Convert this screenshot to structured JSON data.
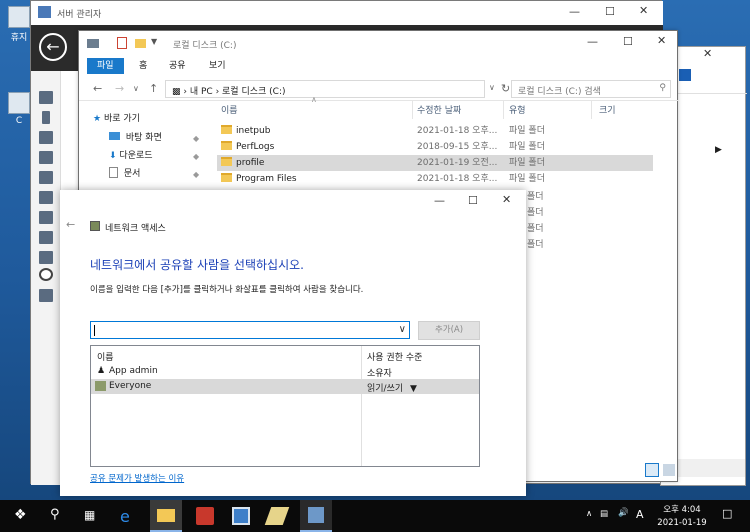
{
  "server_manager": {
    "title": "서버 관리자"
  },
  "desktop": {
    "icon1_label": "휴지",
    "icon2_label": "C"
  },
  "explorer": {
    "title": "로컬 디스크 (C:)",
    "ribbon_tabs": [
      "파일",
      "홈",
      "공유",
      "보기"
    ],
    "address_parts": [
      "내 PC",
      "로컬 디스크 (C:)"
    ],
    "search_placeholder": "로컬 디스크 (C:) 검색",
    "columns": [
      "이름",
      "수정한 날짜",
      "유형",
      "크기"
    ],
    "nav": {
      "quick_access": "바로 가기",
      "items": [
        "바탕 화면",
        "다운로드",
        "문서"
      ]
    },
    "files": [
      {
        "name": "inetpub",
        "date": "2021-01-18 오후...",
        "type": "파일 폴더"
      },
      {
        "name": "PerfLogs",
        "date": "2018-09-15 오후...",
        "type": "파일 폴더"
      },
      {
        "name": "profile",
        "date": "2021-01-19 오전...",
        "type": "파일 폴더"
      },
      {
        "name": "Program Files",
        "date": "2021-01-18 오후...",
        "type": "파일 폴더"
      }
    ],
    "extra_types": [
      "폴더",
      "폴더",
      "폴더",
      "폴더"
    ]
  },
  "dialog": {
    "title": "네트워크 액세스",
    "heading": "네트워크에서 공유할 사람을 선택하십시오.",
    "instruction": "이름을 입력한 다음 [추가]를 클릭하거나 화살표를 클릭하여 사람을 찾습니다.",
    "input_value": "",
    "add_button": "추가(A)",
    "list_headers": [
      "이름",
      "사용 권한 수준"
    ],
    "entries": [
      {
        "name": "App admin",
        "permission": "소유자"
      },
      {
        "name": "Everyone",
        "permission": "읽기/쓰기"
      }
    ],
    "help_link": "공유 문제가 발생하는 이유"
  },
  "taskbar": {
    "time": "오후 4:04",
    "date": "2021-01-19",
    "ime": "A"
  },
  "colors": {
    "accent": "#1979ca",
    "link": "#0066cc",
    "heading": "#1a3fb6",
    "taskbar": "#0a0a0a"
  }
}
